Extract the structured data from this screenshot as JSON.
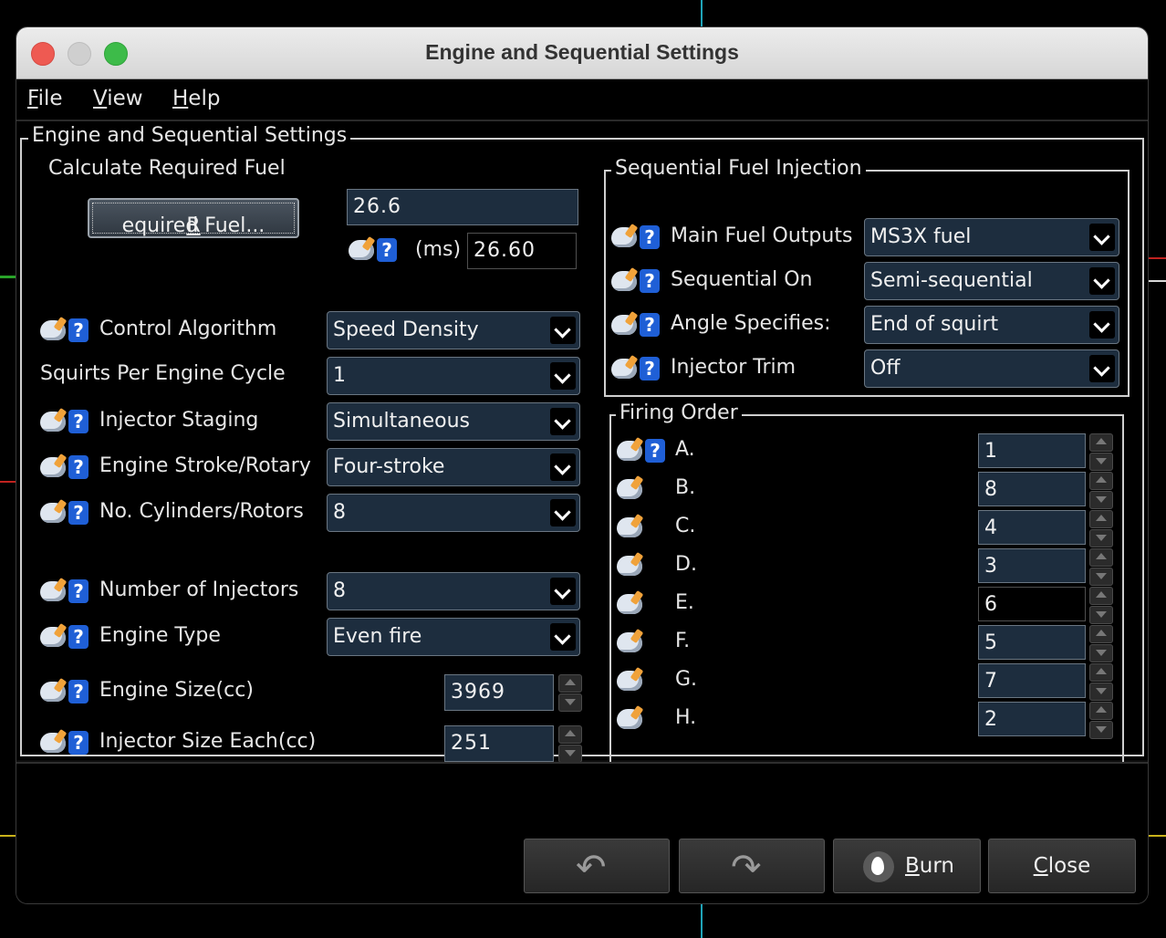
{
  "window": {
    "title": "Engine and Sequential Settings"
  },
  "menu": [
    {
      "mnemonic": "F",
      "rest": "ile"
    },
    {
      "mnemonic": "V",
      "rest": "iew"
    },
    {
      "mnemonic": "H",
      "rest": "elp"
    }
  ],
  "main_group": {
    "title": "Engine and Sequential Settings"
  },
  "req_fuel": {
    "title": "Calculate Required Fuel",
    "button_mnemonic": "R",
    "button_rest": "equired Fuel...",
    "value": "26.6",
    "unit": "(ms)",
    "computed": "26.60"
  },
  "settings": {
    "control_algorithm": {
      "label": "Control Algorithm",
      "value": "Speed Density"
    },
    "squirts": {
      "label": "Squirts Per Engine Cycle",
      "value": "1"
    },
    "injector_staging": {
      "label": "Injector Staging",
      "value": "Simultaneous"
    },
    "engine_stroke": {
      "label": "Engine Stroke/Rotary",
      "value": "Four-stroke"
    },
    "cylinders": {
      "label": "No. Cylinders/Rotors",
      "value": "8"
    },
    "num_injectors": {
      "label": "Number of Injectors",
      "value": "8"
    },
    "engine_type": {
      "label": "Engine Type",
      "value": "Even fire"
    },
    "engine_size": {
      "label": "Engine Size(cc)",
      "value": "3969"
    },
    "injector_size": {
      "label": "Injector Size Each(cc)",
      "value": "251"
    }
  },
  "sequential": {
    "title": "Sequential Fuel Injection",
    "main_fuel_outputs": {
      "label": "Main Fuel Outputs",
      "value": "MS3X fuel"
    },
    "sequential_on": {
      "label": "Sequential On",
      "value": "Semi-sequential"
    },
    "angle_specifies": {
      "label": "Angle Specifies:",
      "value": "End of squirt"
    },
    "injector_trim": {
      "label": "Injector Trim",
      "value": "Off"
    }
  },
  "firing_order": {
    "title": "Firing Order",
    "items": [
      {
        "label": "A.",
        "value": "1"
      },
      {
        "label": "B.",
        "value": "8"
      },
      {
        "label": "C.",
        "value": "4"
      },
      {
        "label": "D.",
        "value": "3"
      },
      {
        "label": "E.",
        "value": "6"
      },
      {
        "label": "F.",
        "value": "5"
      },
      {
        "label": "G.",
        "value": "7"
      },
      {
        "label": "H.",
        "value": "2"
      }
    ]
  },
  "buttons": {
    "burn_mnemonic": "B",
    "burn_rest": "urn",
    "close_mnemonic": "C",
    "close_rest": "lose"
  }
}
